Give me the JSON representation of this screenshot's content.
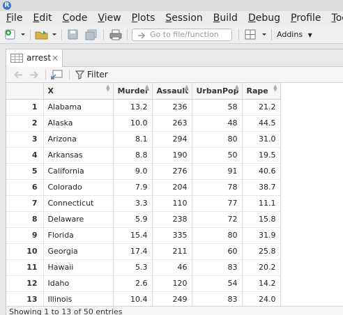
{
  "app": {
    "icon_letter": "R"
  },
  "menu": [
    "File",
    "Edit",
    "Code",
    "View",
    "Plots",
    "Session",
    "Build",
    "Debug",
    "Profile",
    "Tools"
  ],
  "menu_underline": [
    "F",
    "E",
    "C",
    "V",
    "P",
    "S",
    "B",
    "D",
    "P",
    "T"
  ],
  "toolbar": {
    "goto_placeholder": "Go to file/function",
    "addins_label": "Addins"
  },
  "tab": {
    "label": "arrest",
    "close": "×"
  },
  "viewer": {
    "filter_label": "Filter"
  },
  "table": {
    "columns": [
      "",
      "X",
      "Murder",
      "Assault",
      "UrbanPop",
      "Rape"
    ],
    "rows": [
      [
        "1",
        "Alabama",
        "13.2",
        "236",
        "58",
        "21.2"
      ],
      [
        "2",
        "Alaska",
        "10.0",
        "263",
        "48",
        "44.5"
      ],
      [
        "3",
        "Arizona",
        "8.1",
        "294",
        "80",
        "31.0"
      ],
      [
        "4",
        "Arkansas",
        "8.8",
        "190",
        "50",
        "19.5"
      ],
      [
        "5",
        "California",
        "9.0",
        "276",
        "91",
        "40.6"
      ],
      [
        "6",
        "Colorado",
        "7.9",
        "204",
        "78",
        "38.7"
      ],
      [
        "7",
        "Connecticut",
        "3.3",
        "110",
        "77",
        "11.1"
      ],
      [
        "8",
        "Delaware",
        "5.9",
        "238",
        "72",
        "15.8"
      ],
      [
        "9",
        "Florida",
        "15.4",
        "335",
        "80",
        "31.9"
      ],
      [
        "10",
        "Georgia",
        "17.4",
        "211",
        "60",
        "25.8"
      ],
      [
        "11",
        "Hawaii",
        "5.3",
        "46",
        "83",
        "20.2"
      ],
      [
        "12",
        "Idaho",
        "2.6",
        "120",
        "54",
        "14.2"
      ],
      [
        "13",
        "Illinois",
        "10.4",
        "249",
        "83",
        "24.0"
      ]
    ]
  },
  "status": {
    "text": "Showing 1 to 13 of 50 entries"
  },
  "colors": {
    "accent": "#3a78c4",
    "toolbar_bg": "#efefef",
    "grid_border": "#d8d8d8"
  }
}
